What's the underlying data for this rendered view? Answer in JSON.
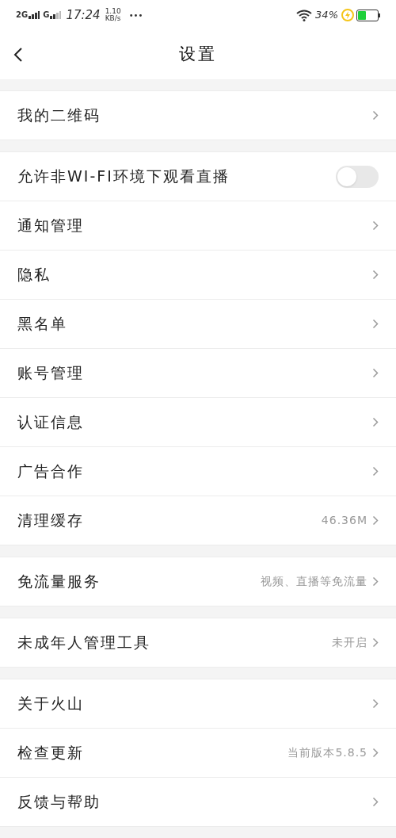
{
  "status_bar": {
    "network_1": "2G",
    "network_2": "G",
    "time": "17:24",
    "speed_value": "1.10",
    "speed_unit": "KB/s",
    "more": "•••",
    "battery_percent": "34%",
    "charging": true
  },
  "header": {
    "title": "设置"
  },
  "groups": [
    {
      "items": [
        {
          "kind": "link",
          "label": "我的二维码"
        }
      ]
    },
    {
      "items": [
        {
          "kind": "toggle",
          "label": "允许非WI-FI环境下观看直播",
          "on": false
        },
        {
          "kind": "link",
          "label": "通知管理"
        },
        {
          "kind": "link",
          "label": "隐私"
        },
        {
          "kind": "link",
          "label": "黑名单"
        },
        {
          "kind": "link",
          "label": "账号管理"
        },
        {
          "kind": "link",
          "label": "认证信息"
        },
        {
          "kind": "link",
          "label": "广告合作"
        },
        {
          "kind": "link",
          "label": "清理缓存",
          "value": "46.36M"
        }
      ]
    },
    {
      "items": [
        {
          "kind": "link",
          "label": "免流量服务",
          "value": "视频、直播等免流量"
        }
      ]
    },
    {
      "items": [
        {
          "kind": "link",
          "label": "未成年人管理工具",
          "value": "未开启"
        }
      ]
    },
    {
      "items": [
        {
          "kind": "link",
          "label": "关于火山"
        },
        {
          "kind": "link",
          "label": "检查更新",
          "value": "当前版本5.8.5"
        },
        {
          "kind": "link",
          "label": "反馈与帮助"
        }
      ]
    }
  ]
}
